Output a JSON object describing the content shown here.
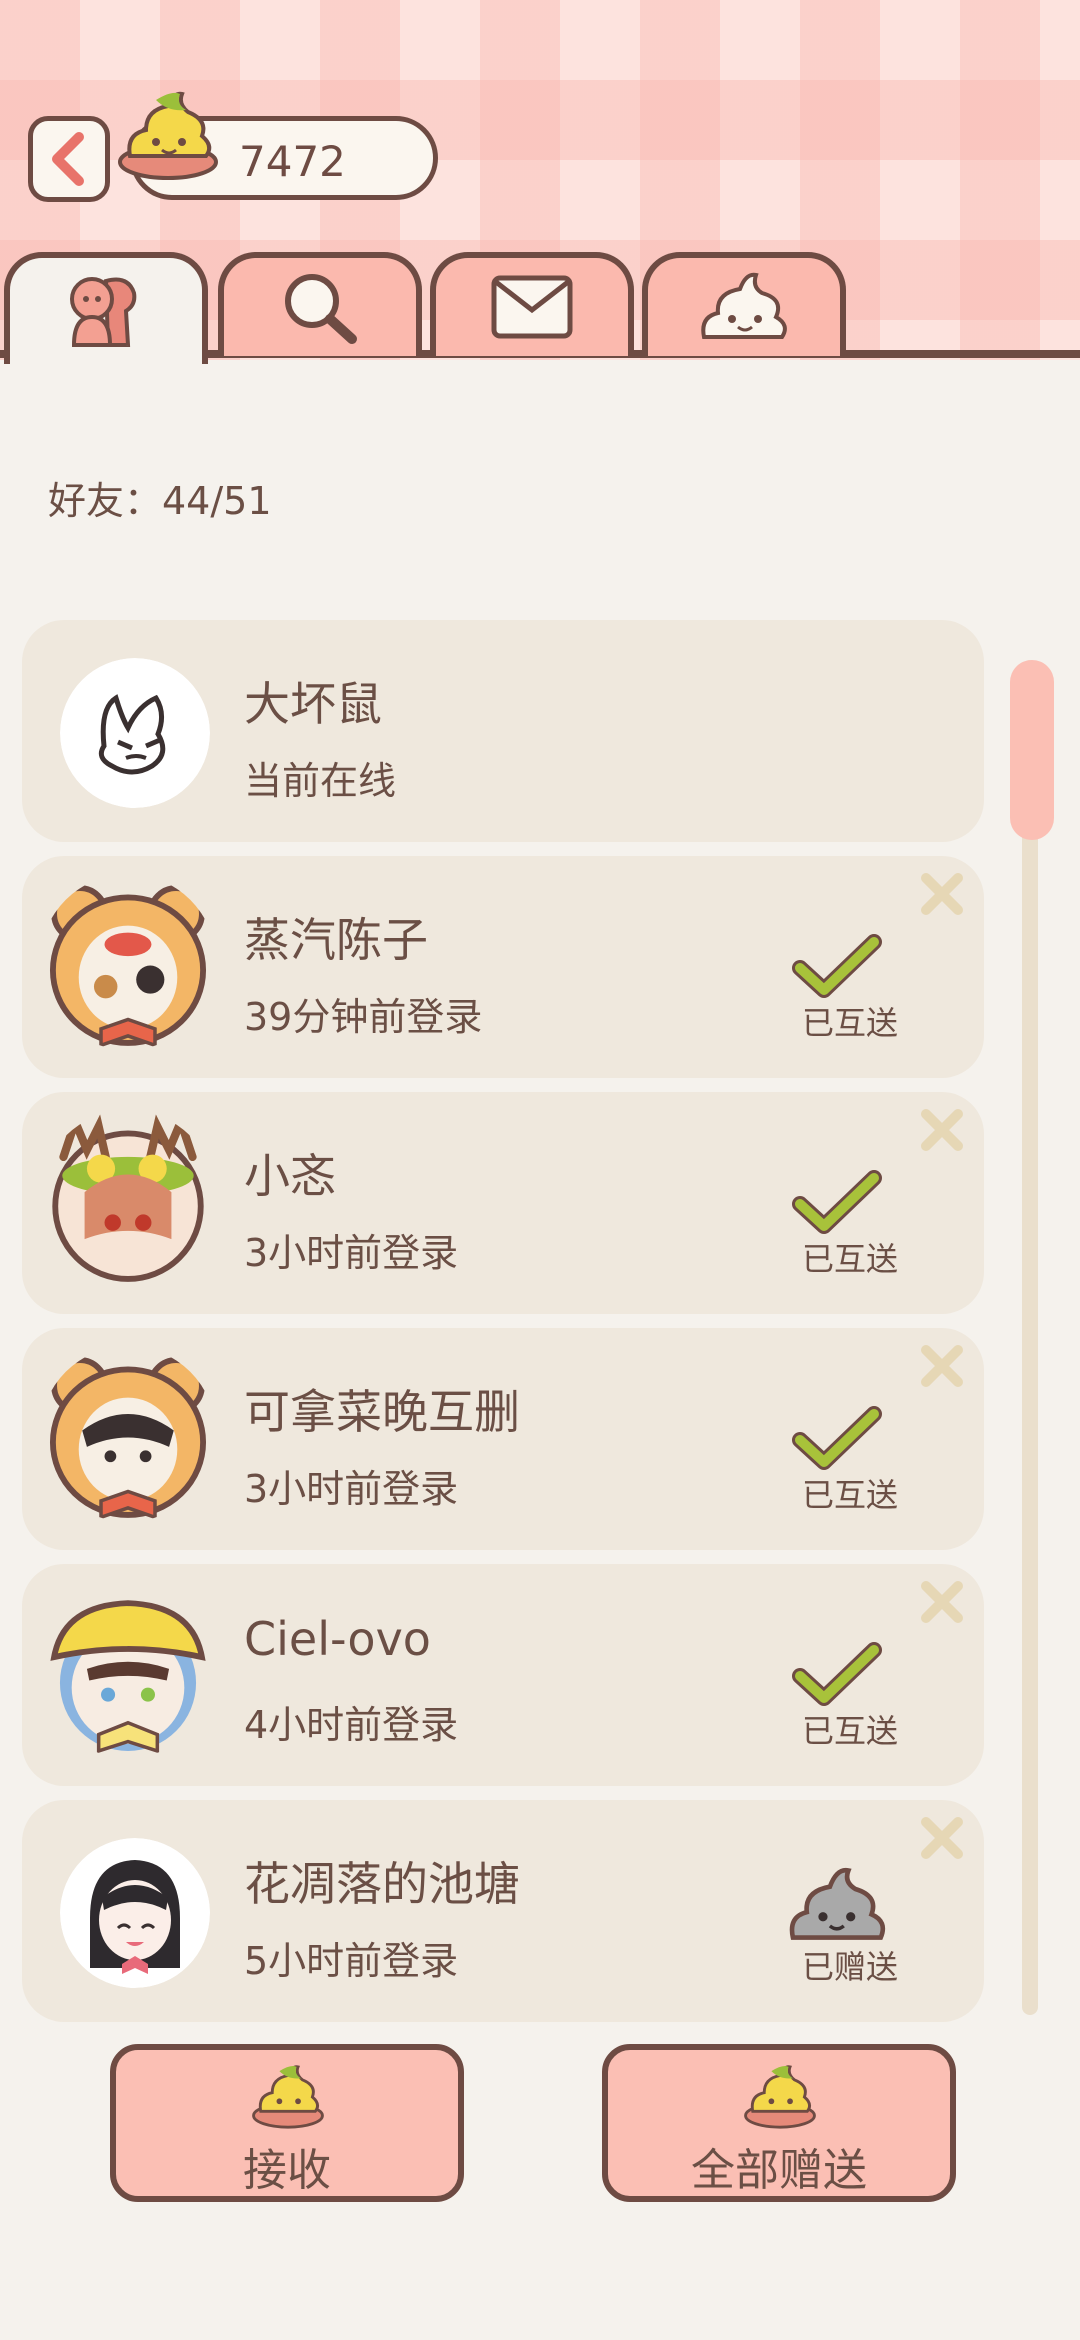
{
  "header": {
    "coin_value": "7472"
  },
  "tabs": [
    {
      "name": "friends-tab",
      "icon": "friends-icon"
    },
    {
      "name": "search-tab",
      "icon": "search-icon"
    },
    {
      "name": "mail-tab",
      "icon": "mail-icon"
    },
    {
      "name": "poop-tab",
      "icon": "poop-icon"
    }
  ],
  "friend_count_label": "好友：44/51",
  "friends": [
    {
      "name": "大坏鼠",
      "status": "当前在线",
      "state": "",
      "avatar": "bunny-avatar"
    },
    {
      "name": "蒸汽陈子",
      "status": "39分钟前登录",
      "state": "已互送",
      "avatar": "bear-avatar"
    },
    {
      "name": "小忞",
      "status": "3小时前登录",
      "state": "已互送",
      "avatar": "deer-avatar"
    },
    {
      "name": "可拿菜晚互删",
      "status": "3小时前登录",
      "state": "已互送",
      "avatar": "bear-avatar"
    },
    {
      "name": "Ciel-ovo",
      "status": "4小时前登录",
      "state": "已互送",
      "avatar": "hat-avatar"
    },
    {
      "name": "花凋落的池塘",
      "status": "5小时前登录",
      "state": "已赠送",
      "avatar": "girl-avatar"
    }
  ],
  "buttons": {
    "receive": "接收",
    "give_all": "全部赠送"
  },
  "colors": {
    "brown": "#6e4b43",
    "pink": "#fbbfb4",
    "card": "#efe8dd",
    "check_green": "#a8c23a"
  }
}
